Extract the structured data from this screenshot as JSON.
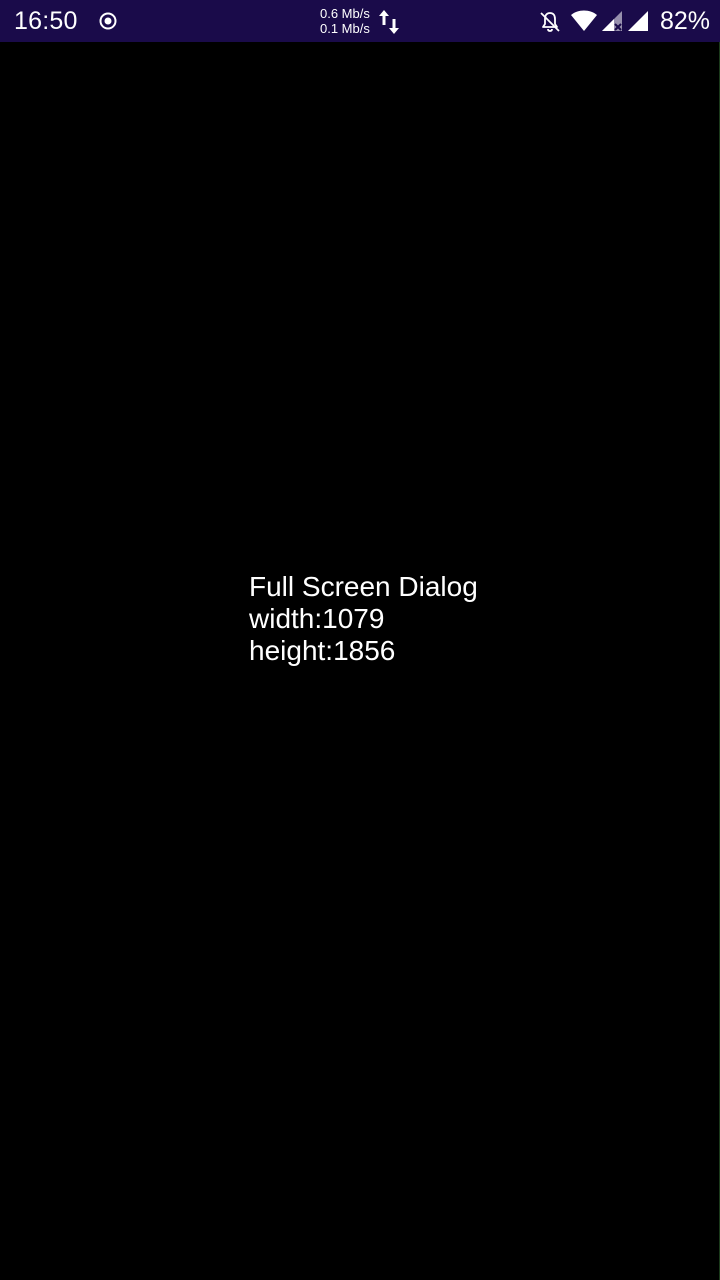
{
  "status_bar": {
    "time": "16:50",
    "upload_speed": "0.6 Mb/s",
    "download_speed": "0.1 Mb/s",
    "battery": "82%",
    "icons": [
      "record-icon",
      "data-transfer-icon",
      "notifications-off-icon",
      "wifi-icon",
      "signal-icon",
      "signal-no-data-icon"
    ],
    "background_color": "#1a0b4a"
  },
  "dialog": {
    "title": "Full Screen Dialog",
    "width_text": "width:1079",
    "height_text": "height:1856",
    "background_color": "#000000"
  }
}
